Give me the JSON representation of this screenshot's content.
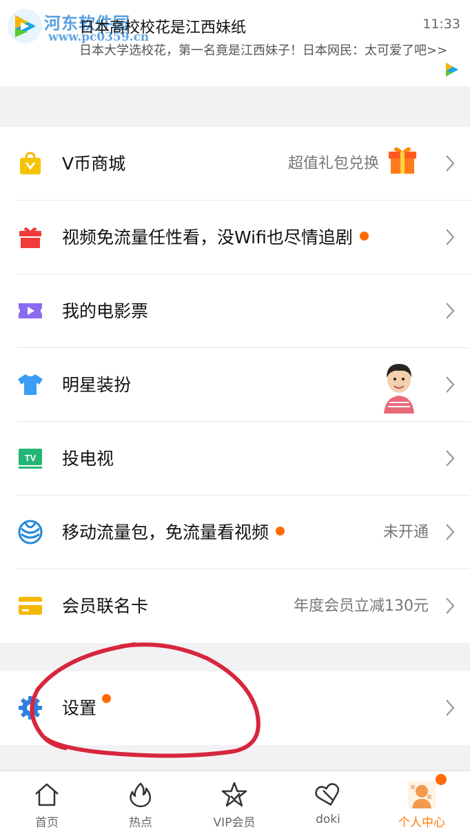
{
  "notification": {
    "watermark_title": "河东软件园",
    "watermark_url": "www.pc0359.cn",
    "title": "日本高校校花是江西妹纸",
    "time": "11:33",
    "body": "日本大学选校花，第一名竟是江西妹子！日本网民：太可爱了吧>>"
  },
  "menu": {
    "vcoin": {
      "label": "V币商城",
      "value": "超值礼包兑换",
      "icon": "bag-icon"
    },
    "freeflow": {
      "label": "视频免流量任性看，没Wifi也尽情追剧",
      "icon": "gift-box-icon"
    },
    "tickets": {
      "label": "我的电影票",
      "icon": "ticket-icon"
    },
    "dressup": {
      "label": "明星装扮",
      "icon": "tshirt-icon"
    },
    "tv": {
      "label": "投电视",
      "icon": "tv-icon"
    },
    "mobile": {
      "label": "移动流量包，免流量看视频",
      "value": "未开通",
      "icon": "china-mobile-icon"
    },
    "card": {
      "label": "会员联名卡",
      "value": "年度会员立减130元",
      "icon": "card-icon"
    },
    "settings": {
      "label": "设置",
      "icon": "gear-icon"
    }
  },
  "tabbar": {
    "home": "首页",
    "hot": "热点",
    "vip": "VIP会员",
    "doki": "doki",
    "me": "个人中心"
  },
  "colors": {
    "accent": "#ff7a00",
    "badge": "#ff6a00",
    "annotation": "#d7263d"
  }
}
